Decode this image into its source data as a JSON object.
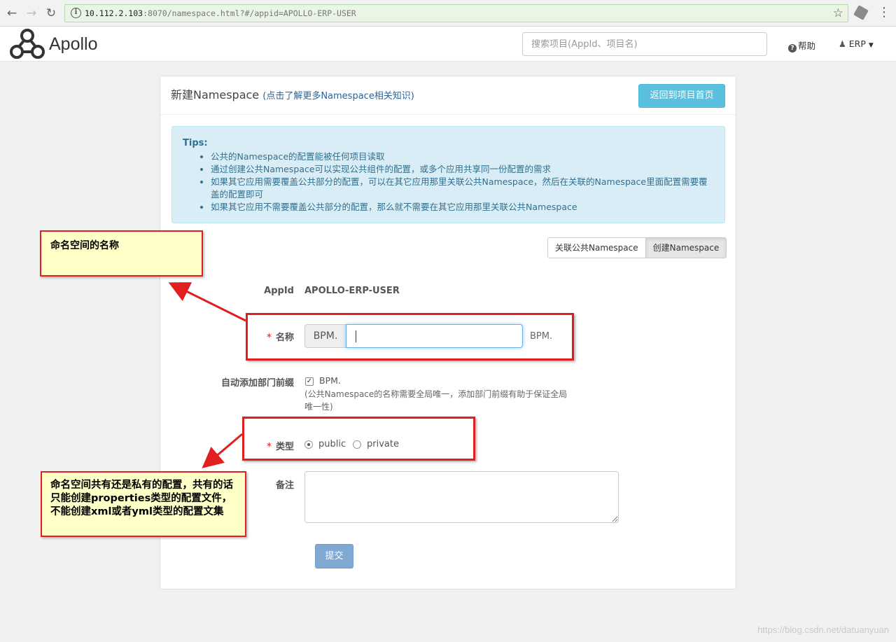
{
  "browser": {
    "url_host": "10.112.2.103",
    "url_rest": ":8070/namespace.html?#/appid=APOLLO-ERP-USER"
  },
  "header": {
    "brand": "Apollo",
    "search_placeholder": "搜索项目(AppId、项目名)",
    "help_label": "帮助",
    "user_label": "ERP"
  },
  "panel": {
    "title": "新建Namespace",
    "title_link": "(点击了解更多Namespace相关知识)",
    "back_button": "返回到项目首页",
    "tips_label": "Tips:",
    "tips": [
      "公共的Namespace的配置能被任何项目读取",
      "通过创建公共Namespace可以实现公共组件的配置，或多个应用共享同一份配置的需求",
      "如果其它应用需要覆盖公共部分的配置，可以在其它应用那里关联公共Namespace，然后在关联的Namespace里面配置需要覆盖的配置即可",
      "如果其它应用不需要覆盖公共部分的配置，那么就不需要在其它应用那里关联公共Namespace"
    ],
    "tab_associate": "关联公共Namespace",
    "tab_create": "创建Namespace"
  },
  "form": {
    "appid_label": "AppId",
    "appid_value": "APOLLO-ERP-USER",
    "required_mark": "*",
    "name_label": "名称",
    "name_prefix": "BPM.",
    "name_suffix": "BPM.",
    "auto_prefix_label": "自动添加部门前缀",
    "auto_prefix_value": "BPM.",
    "auto_prefix_checked": true,
    "auto_prefix_help": "(公共Namespace的名称需要全局唯一，添加部门前缀有助于保证全局唯一性)",
    "type_label": "类型",
    "type_options": [
      "public",
      "private"
    ],
    "type_selected": "public",
    "remark_label": "备注",
    "submit": "提交"
  },
  "annotations": {
    "note_name": "命名空间的名称",
    "note_type": "命名空间共有还是私有的配置，共有的话只能创建properties类型的配置文件，不能创建xml或者yml类型的配置文集"
  },
  "watermark": "https://blog.csdn.net/datuanyuan",
  "colors": {
    "highlight_red": "#e02020",
    "note_bg": "#ffffc8",
    "info_button": "#5bc0de",
    "tips_bg": "#d9edf7",
    "submit_bg": "#7fa8d2"
  }
}
